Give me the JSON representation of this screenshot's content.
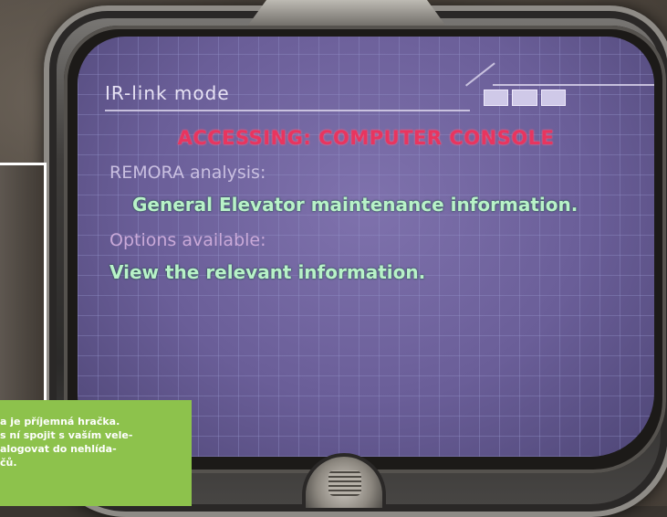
{
  "hud": {
    "mode_title": "IR-link mode",
    "accessing": "ACCESSING: COMPUTER CONSOLE",
    "analysis_label": "REMORA analysis:",
    "analysis_text": "General Elevator maintenance information.",
    "options_label": "Options available:",
    "option_text": "View the relevant information."
  },
  "caption": {
    "lines": [
      "a je příjemná hračka.",
      "s ní spojit s vaším vele-",
      "alogovat do nehlída-",
      "čů."
    ]
  },
  "colors": {
    "accent_red": "#e8355f",
    "info_green": "#b8f2c8",
    "screen_purple": "#6a5e98",
    "caption_green": "#8dc24c"
  }
}
